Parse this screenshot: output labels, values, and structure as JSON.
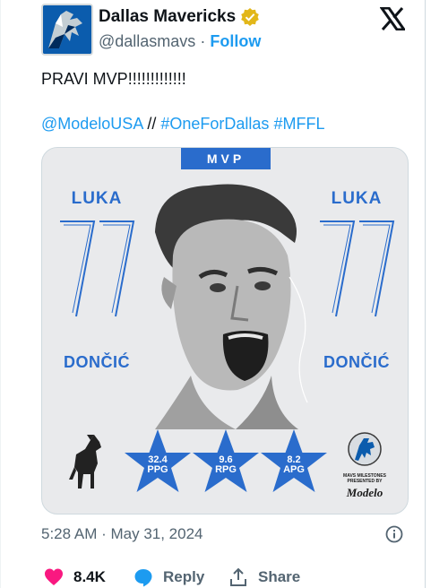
{
  "author": {
    "name": "Dallas Mavericks",
    "handle": "@dallasmavs",
    "separator": "·",
    "follow_label": "Follow"
  },
  "tweet": {
    "text": "PRAVI MVP!!!!!!!!!!!!!",
    "mentions": [
      "@ModeloUSA",
      "//",
      "#OneForDallas",
      "#MFFL"
    ]
  },
  "media": {
    "banner": "MVP",
    "player_first": "LUKA",
    "player_last": "DONČIĆ",
    "jersey_number": "77",
    "stats": [
      {
        "value": "32.4",
        "unit": "PPG"
      },
      {
        "value": "9.6",
        "unit": "RPG"
      },
      {
        "value": "8.2",
        "unit": "APG"
      }
    ],
    "sponsor_caption": "MAVS MILESTONES PRESENTED BY",
    "sponsor": "Modelo",
    "accent_color": "#2a6ccc"
  },
  "meta": {
    "timestamp": "5:28 AM · May 31, 2024"
  },
  "actions": {
    "like_count": "8.4K",
    "reply_label": "Reply",
    "share_label": "Share"
  },
  "icons": [
    "verified-badge-icon",
    "x-logo-icon",
    "info-icon",
    "heart-icon",
    "reply-bubble-icon",
    "share-icon",
    "horse-icon",
    "mavs-logo-icon"
  ]
}
